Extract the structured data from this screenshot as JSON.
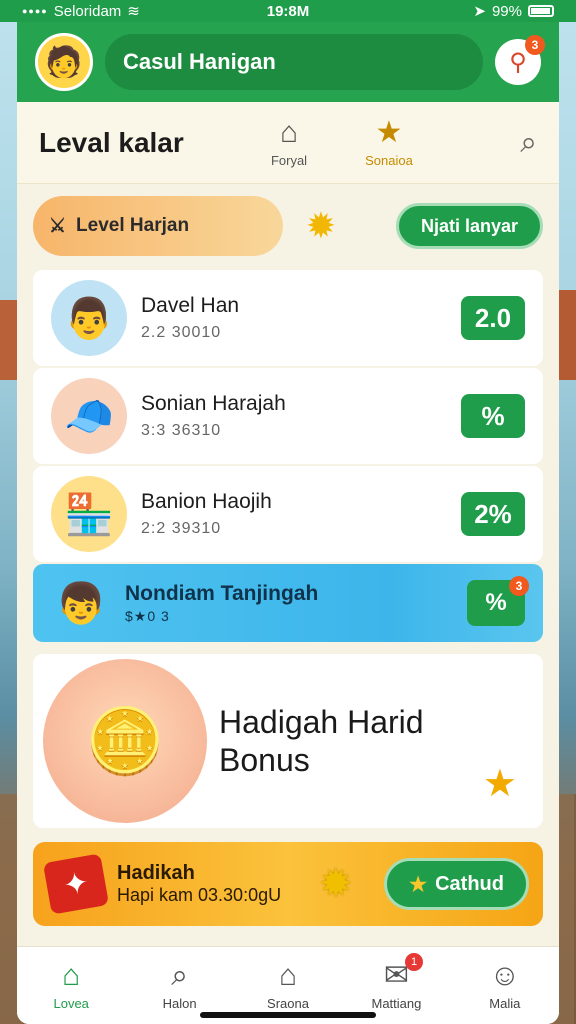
{
  "status_bar": {
    "carrier": "Seloridam",
    "time": "19:8M",
    "battery": "99%"
  },
  "header": {
    "title": "Casul Hanigan",
    "notification_count": "3"
  },
  "subheader": {
    "title": "Leval kalar",
    "tabs": [
      {
        "label": "Foryal"
      },
      {
        "label": "Sonaioa"
      }
    ]
  },
  "level_row": {
    "label": "Level Harjan",
    "button_label": "Njati lanyar"
  },
  "players": [
    {
      "name": "Davel Han",
      "score": "2.2 30010",
      "chip": "2.0"
    },
    {
      "name": "Sonian Harajah",
      "score": "3:3 36310",
      "chip": "%"
    },
    {
      "name": "Banion Haojih",
      "score": "2:2 39310",
      "chip": "2%"
    },
    {
      "name": "Nondiam Tanjingah",
      "score": "$★0 3",
      "chip": "%",
      "chip_badge": "3"
    }
  ],
  "bonus": {
    "title_line1": "Hadigah Harid",
    "title_line2": "Bonus"
  },
  "reward": {
    "title": "Hadikah",
    "subtitle": "Hapi kam 03.30:0gU",
    "button_label": "Cathud"
  },
  "bottom_nav": [
    {
      "label": "Lovea"
    },
    {
      "label": "Halon"
    },
    {
      "label": "Sraona"
    },
    {
      "label": "Mattiang",
      "badge": "1"
    },
    {
      "label": "Malia"
    }
  ],
  "colors": {
    "primary_green": "#1f9d4a",
    "accent_orange": "#f7a21c",
    "highlight_blue": "#4fc3f0"
  }
}
